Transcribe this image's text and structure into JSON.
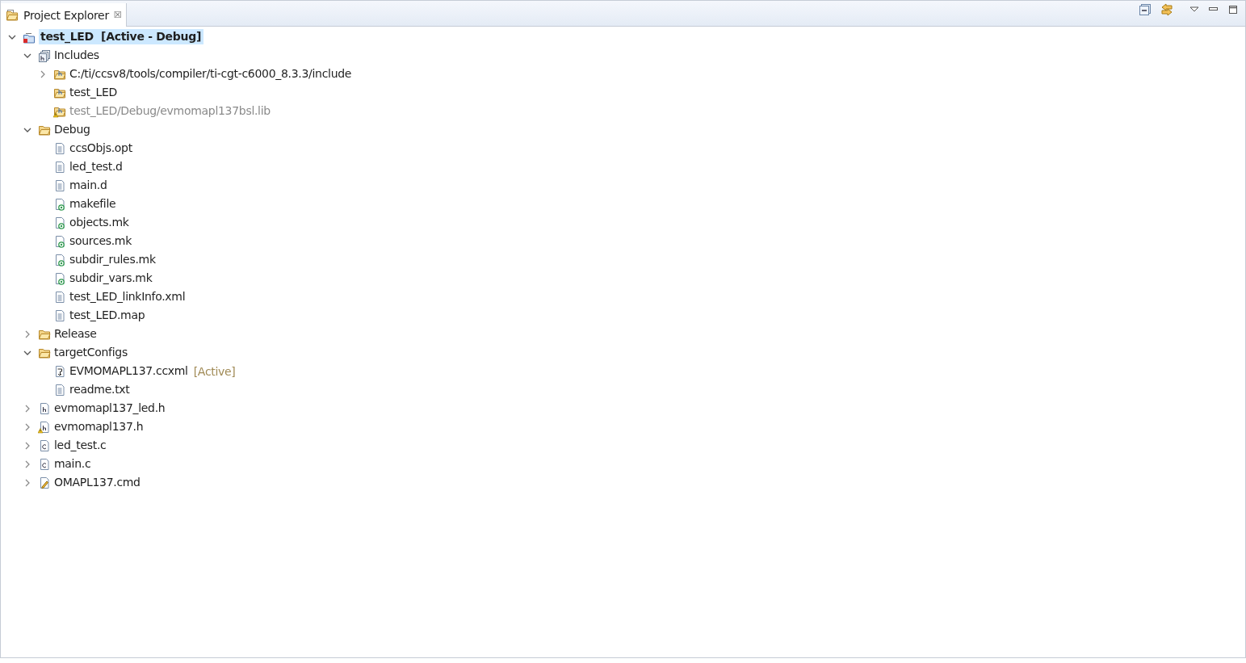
{
  "view_tab": {
    "title": "Project Explorer",
    "close": "☒"
  },
  "tree": [
    {
      "label": "test_LED",
      "suffix": "[Active - Debug]",
      "kind": "project",
      "selected": true,
      "expanded": true,
      "warning": false,
      "disabled": false,
      "children": [
        {
          "label": "Includes",
          "kind": "includes",
          "selected": false,
          "expanded": true,
          "warning": false,
          "disabled": false,
          "children": [
            {
              "label": "C:/ti/ccsv8/tools/compiler/ti-cgt-c6000_8.3.3/include",
              "kind": "include-folder",
              "selected": false,
              "expanded": false,
              "warning": false,
              "disabled": false
            },
            {
              "label": "test_LED",
              "kind": "include-folder",
              "selected": false,
              "warning": false,
              "disabled": false
            },
            {
              "label": "test_LED/Debug/evmomapl137bsl.lib",
              "kind": "include-folder",
              "selected": false,
              "warning": true,
              "disabled": true
            }
          ]
        },
        {
          "label": "Debug",
          "kind": "folder",
          "selected": false,
          "expanded": true,
          "warning": false,
          "disabled": false,
          "children": [
            {
              "label": "ccsObjs.opt",
              "kind": "file",
              "selected": false,
              "warning": false,
              "disabled": false
            },
            {
              "label": "led_test.d",
              "kind": "file",
              "selected": false,
              "warning": false,
              "disabled": false
            },
            {
              "label": "main.d",
              "kind": "file",
              "selected": false,
              "warning": false,
              "disabled": false
            },
            {
              "label": "makefile",
              "kind": "make-file",
              "selected": false,
              "warning": false,
              "disabled": false
            },
            {
              "label": "objects.mk",
              "kind": "make-file",
              "selected": false,
              "warning": false,
              "disabled": false
            },
            {
              "label": "sources.mk",
              "kind": "make-file",
              "selected": false,
              "warning": false,
              "disabled": false
            },
            {
              "label": "subdir_rules.mk",
              "kind": "make-file",
              "selected": false,
              "warning": false,
              "disabled": false
            },
            {
              "label": "subdir_vars.mk",
              "kind": "make-file",
              "selected": false,
              "warning": false,
              "disabled": false
            },
            {
              "label": "test_LED_linkInfo.xml",
              "kind": "file",
              "selected": false,
              "warning": false,
              "disabled": false
            },
            {
              "label": "test_LED.map",
              "kind": "file",
              "selected": false,
              "warning": false,
              "disabled": false
            }
          ]
        },
        {
          "label": "Release",
          "kind": "folder",
          "selected": false,
          "expanded": false,
          "warning": false,
          "disabled": false
        },
        {
          "label": "targetConfigs",
          "kind": "folder",
          "selected": false,
          "expanded": true,
          "warning": false,
          "disabled": false,
          "children": [
            {
              "label": "EVMOMAPL137.ccxml",
              "suffix": "[Active]",
              "kind": "target-config",
              "selected": false,
              "warning": false,
              "disabled": false
            },
            {
              "label": "readme.txt",
              "kind": "file",
              "selected": false,
              "warning": false,
              "disabled": false
            }
          ]
        },
        {
          "label": "evmomapl137_led.h",
          "kind": "header",
          "selected": false,
          "expanded": false,
          "warning": false,
          "disabled": false
        },
        {
          "label": "evmomapl137.h",
          "kind": "header",
          "selected": false,
          "expanded": false,
          "warning": true,
          "disabled": false
        },
        {
          "label": "led_test.c",
          "kind": "c-source",
          "selected": false,
          "expanded": false,
          "warning": false,
          "disabled": false
        },
        {
          "label": "main.c",
          "kind": "c-source",
          "selected": false,
          "expanded": false,
          "warning": false,
          "disabled": false
        },
        {
          "label": "OMAPL137.cmd",
          "kind": "cmd-file",
          "selected": false,
          "expanded": false,
          "warning": false,
          "disabled": false
        }
      ]
    }
  ]
}
